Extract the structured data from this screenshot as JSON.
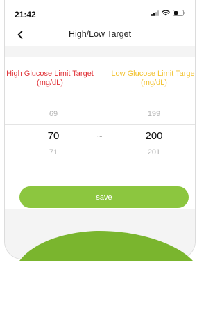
{
  "status_bar": {
    "time": "21:42"
  },
  "nav": {
    "title": "High/Low Target",
    "back_icon": "chevron-left-icon"
  },
  "targets": {
    "high_label_line1": "High Glucose Limit Target",
    "high_label_line2": "(mg/dL)",
    "low_label_line1": "Low Glucose Limit Target",
    "low_label_line2": "(mg/dL)",
    "high_color": "#e0353a",
    "low_color": "#f2c230"
  },
  "picker": {
    "high": {
      "prev": "69",
      "selected": "70",
      "next": "71"
    },
    "low": {
      "prev": "199",
      "selected": "200",
      "next": "201"
    },
    "separator": "~"
  },
  "save_button": {
    "label": "save",
    "color": "#8cc63f"
  },
  "accent_green": "#7ab52e"
}
